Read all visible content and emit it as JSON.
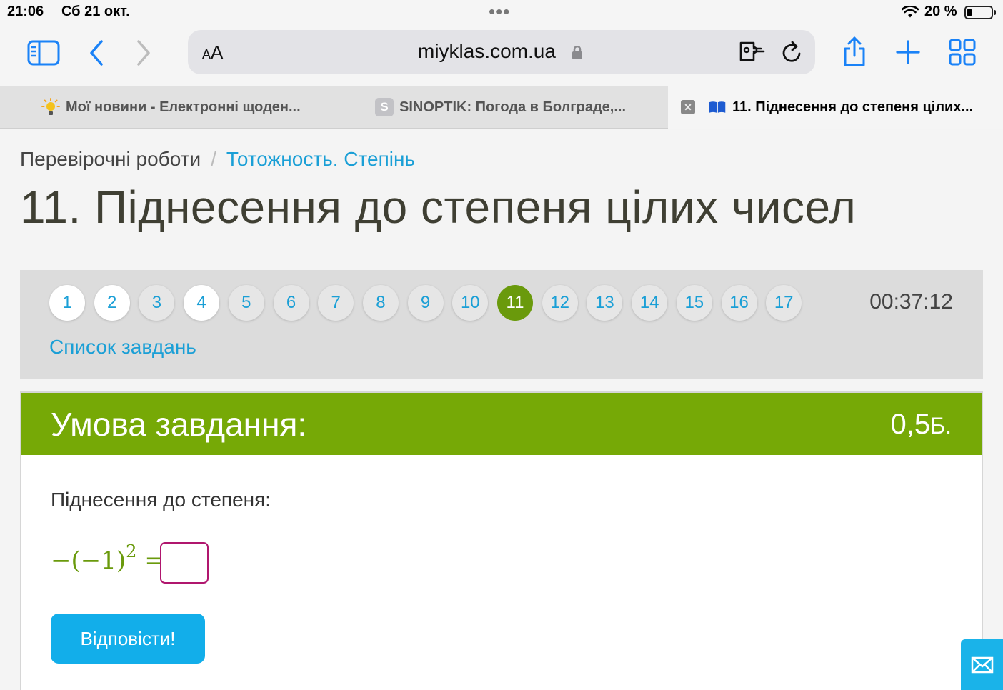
{
  "status": {
    "time": "21:06",
    "date": "Сб 21 окт.",
    "battery": "20 %",
    "battery_level": 0.2
  },
  "toolbar": {
    "text_size_label_small": "A",
    "text_size_label_large": "A",
    "domain": "miyklas.com.ua",
    "icons": [
      "sidebar-icon",
      "back-icon",
      "forward-icon",
      "lock-icon",
      "extension-icon",
      "reload-icon",
      "share-icon",
      "new-tab-icon",
      "tabs-overview-icon"
    ]
  },
  "tabs": [
    {
      "label": "Мої новини - Електронні щоден...",
      "icon": "sun-icon"
    },
    {
      "label": "SINOPTIK: Погода в Болграде,...",
      "icon": "S"
    },
    {
      "label": "11. Піднесення до степеня цілих...",
      "icon": "book-icon",
      "active": true
    }
  ],
  "breadcrumb": {
    "root": "Перевірочні роботи",
    "separator": "/",
    "current": "Тотожность. Степінь"
  },
  "page_title": "11. Піднесення до степеня цілих чисел",
  "navigation": {
    "tasks": [
      "1",
      "2",
      "3",
      "4",
      "5",
      "6",
      "7",
      "8",
      "9",
      "10",
      "11",
      "12",
      "13",
      "14",
      "15",
      "16",
      "17"
    ],
    "completed": [
      "1",
      "2",
      "4"
    ],
    "current": "11",
    "timer": "00:37:12",
    "task_list_label": "Список завдань"
  },
  "task": {
    "header": "Умова завдання:",
    "points": "0,5",
    "points_unit": "Б.",
    "question": "Піднесення до степеня:",
    "expression_main": "−(−1)",
    "expression_exp": "2",
    "expression_eq": " =",
    "answer_value": "",
    "submit_label": "Відповісти!"
  },
  "colors": {
    "accent_green": "#76a906",
    "current_circle": "#6a9a0c",
    "link_blue": "#1a9fd6",
    "button_blue": "#12aeea",
    "answer_border": "#b0166e"
  }
}
